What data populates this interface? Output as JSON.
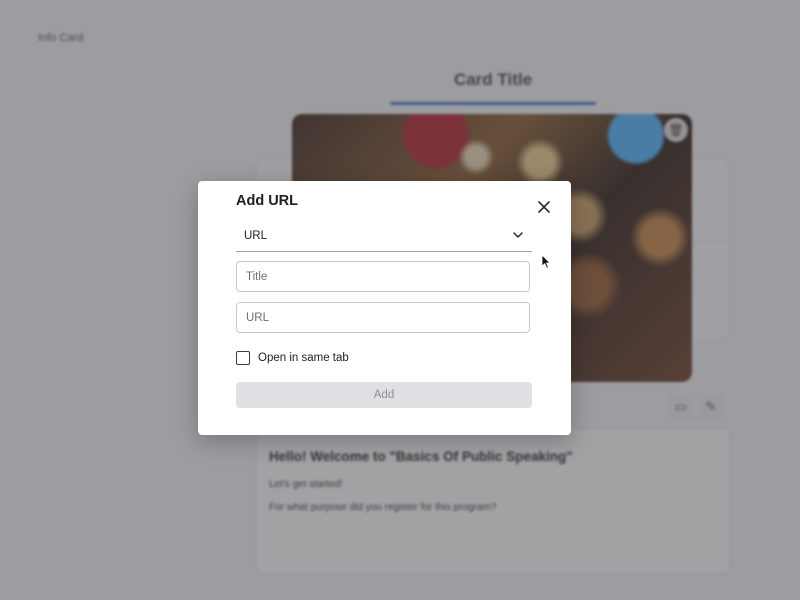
{
  "background": {
    "breadcrumb": "Info Card",
    "card_title": "Card Title",
    "content": {
      "heading": "Hello! Welcome to \"Basics Of Public Speaking\"",
      "line1": "Let's get started!",
      "line2": "For what purpose did you register for this program?"
    }
  },
  "modal": {
    "title": "Add URL",
    "type_select": {
      "value": "URL"
    },
    "title_field": {
      "placeholder": "Title",
      "value": ""
    },
    "url_field": {
      "placeholder": "URL",
      "value": ""
    },
    "open_same_tab": {
      "label": "Open in same tab",
      "checked": false
    },
    "add_button": {
      "label": "Add",
      "disabled": true
    }
  },
  "colors": {
    "accent": "#3e6fd8",
    "overlay": "#46464c",
    "button_disabled_bg": "#dfe0e4",
    "button_disabled_text": "#8d8f96"
  }
}
